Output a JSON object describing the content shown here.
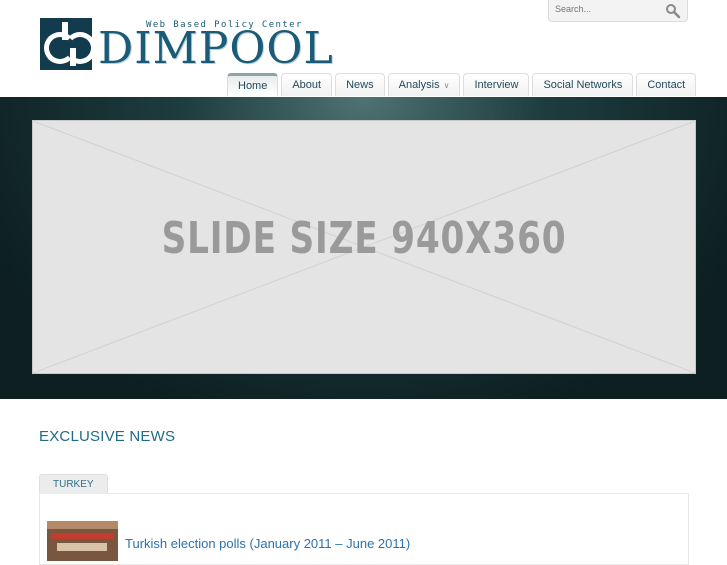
{
  "header": {
    "logo": {
      "tagline": "Web Based Policy Center",
      "name": "DIMPOOL"
    },
    "search": {
      "placeholder": "Search..."
    }
  },
  "nav": {
    "items": [
      {
        "label": "Home",
        "active": true
      },
      {
        "label": "About"
      },
      {
        "label": "News"
      },
      {
        "label": "Analysis",
        "has_dropdown": true,
        "dropdown_icon": "chevron-down-icon"
      },
      {
        "label": "Interview"
      },
      {
        "label": "Social Networks"
      },
      {
        "label": "Contact"
      }
    ]
  },
  "slider": {
    "placeholder_text": "SLIDE SIZE 940X360"
  },
  "main": {
    "section_title": "EXCLUSIVE NEWS",
    "tabs": [
      {
        "label": "TURKEY"
      }
    ],
    "news": [
      {
        "title": "Turkish election polls (January 2011 – June 2011)"
      }
    ]
  },
  "colors": {
    "brand": "#1a5b78",
    "slider_bg": "#0d1f21",
    "link": "#2c72b0",
    "section_title": "#1f6b8a"
  }
}
